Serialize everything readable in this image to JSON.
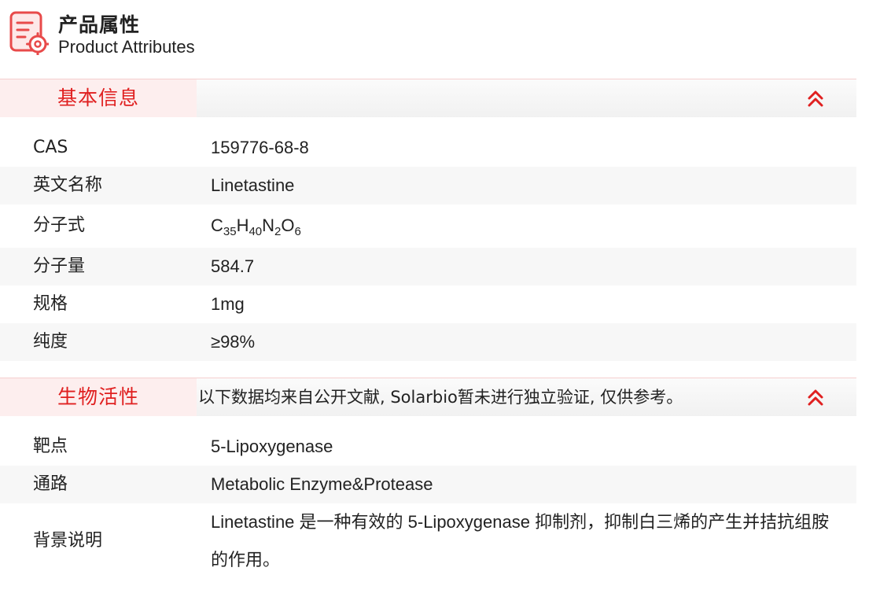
{
  "header": {
    "title_cn": "产品属性",
    "title_en": "Product Attributes",
    "icon": "document-gear-icon",
    "accent_color": "#e02020"
  },
  "basic_info": {
    "title": "基本信息",
    "collapse_icon": "double-chevron-up-icon",
    "rows": [
      {
        "label": "CAS",
        "value": "159776-68-8"
      },
      {
        "label": "英文名称",
        "value": "Linetastine"
      },
      {
        "label": "分子式",
        "formula": [
          {
            "text": "C",
            "sub": "35"
          },
          {
            "text": "H",
            "sub": "40"
          },
          {
            "text": "N",
            "sub": "2"
          },
          {
            "text": "O",
            "sub": "6"
          }
        ]
      },
      {
        "label": "分子量",
        "value": "584.7"
      },
      {
        "label": "规格",
        "value": "1mg"
      },
      {
        "label": "纯度",
        "value": "≥98%"
      }
    ]
  },
  "bio_activity": {
    "title": "生物活性",
    "note": "以下数据均来自公开文献, Solarbio暂未进行独立验证, 仅供参考。",
    "collapse_icon": "double-chevron-up-icon",
    "rows": [
      {
        "label": "靶点",
        "value": "5-Lipoxygenase"
      },
      {
        "label": "通路",
        "value": "Metabolic Enzyme&Protease"
      },
      {
        "label": "背景说明",
        "value": "Linetastine 是一种有效的 5-Lipoxygenase 抑制剂，抑制白三烯的产生并拮抗组胺的作用。"
      }
    ]
  }
}
